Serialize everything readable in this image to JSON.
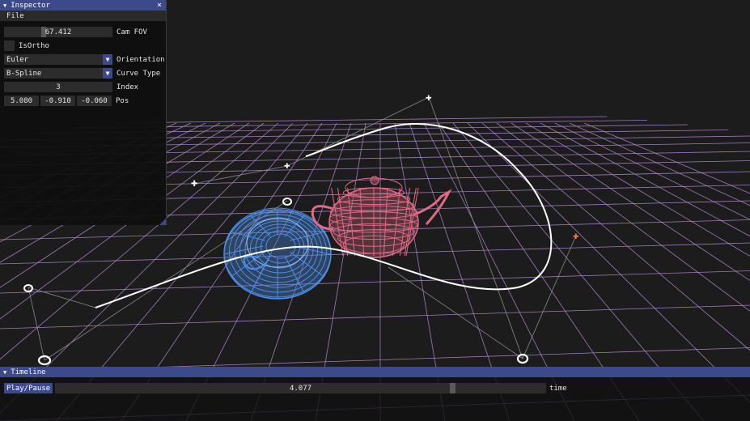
{
  "inspector": {
    "title": "Inspector",
    "close_glyph": "×",
    "collapse_glyph": "▼",
    "menu_file": "File",
    "cam_fov": {
      "value": "67.412",
      "label": "Cam FOV"
    },
    "is_ortho": {
      "label": "IsOrtho",
      "checked": false
    },
    "orientation": {
      "value": "Euler",
      "label": "Orientation"
    },
    "curve_type": {
      "value": "B-Spline",
      "label": "Curve Type"
    },
    "index": {
      "value": "3",
      "label": "Index"
    },
    "pos": {
      "x": "5.080",
      "y": "-0.910",
      "z": "-0.060",
      "label": "Pos"
    }
  },
  "timeline": {
    "title": "Timeline",
    "collapse_glyph": "▼",
    "play_pause_label": "Play/Pause",
    "time_value": "4.077",
    "time_label": "time"
  },
  "scene": {
    "grid_color": "#b98ad6",
    "teapot_color": "#e06a85",
    "teacup_color": "#4d8fe8",
    "curve_color": "#ffffff",
    "selected_control_point_color": "#ff7a4a",
    "icons": [
      "wireframe-teapot",
      "wireframe-teacup",
      "bspline-curve",
      "control-point-handle"
    ]
  },
  "colors": {
    "accent": "#3c4a8a",
    "panel_bg": "#0f0f0f",
    "field_bg": "#2c2c2c"
  }
}
